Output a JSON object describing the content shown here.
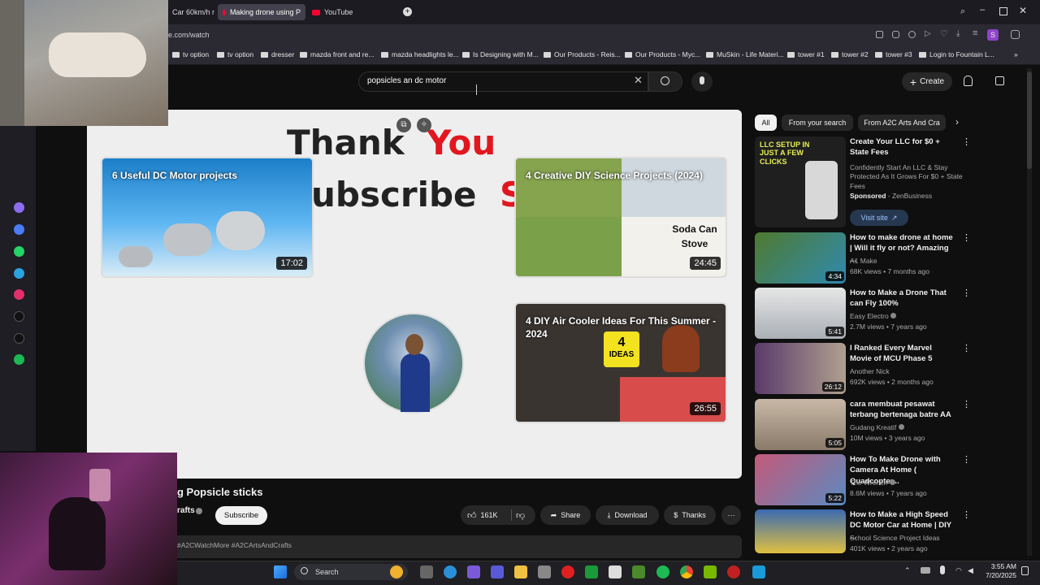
{
  "browser": {
    "tabs": [
      {
        "label": "Car 60km/h m",
        "active": false
      },
      {
        "label": "Making drone using P",
        "active": true
      },
      {
        "label": "YouTube",
        "active": false
      }
    ],
    "url": "e.com/watch",
    "bookmarks": [
      "tv option",
      "tv option",
      "dresser",
      "mazda front and re...",
      "mazda headlights le...",
      "Is Designing with M...",
      "Our Products - Reis...",
      "Our Products - Myc...",
      "MuSkin - Life Materi...",
      "tower #1",
      "tower #2",
      "tower #3",
      "Login to Fountain L..."
    ],
    "bookmarks_more": "»"
  },
  "youtube": {
    "search_value": "popsicles an dc motor",
    "create_label": "Create"
  },
  "video": {
    "endscreen_text_1": "Thank",
    "endscreen_text_1b": "You",
    "endscreen_text_2": "ubscribe",
    "endscreen_text_2b": "S",
    "cards": [
      {
        "title": "6 Useful DC Motor projects",
        "duration": "17:02"
      },
      {
        "title": "4 Creative DIY Science Projects (2024)",
        "duration": "24:45",
        "overlay_a": "Soda Can",
        "overlay_b": "Stove"
      },
      {
        "title": "4 DIY Air Cooler Ideas For This Summer - 2024",
        "duration": "26:55",
        "badge_num": "4",
        "badge_word": "IDEAS"
      }
    ]
  },
  "below_video": {
    "title": "g Popsicle sticks",
    "channel": "rafts",
    "subscribe": "Subscribe",
    "likes": "161K",
    "share": "Share",
    "download": "Download",
    "thanks": "Thanks",
    "more": "···",
    "hashtags": "#A2CWatchMore #A2CArtsAndCrafts"
  },
  "chips": [
    "All",
    "From your search",
    "From A2C Arts And Cra"
  ],
  "sponsored": {
    "thumb_text": "LLC SETUP IN JUST A FEW CLICKS",
    "title": "Create Your LLC for $0 + State Fees",
    "desc": "Confidently Start An LLC & Stay Protected As It Grows For $0 + State Fees",
    "label": "Sponsored",
    "advertiser": "ZenBusiness",
    "cta": "Visit site"
  },
  "related": [
    {
      "title": "How to make drone at home | Will it fly or not? Amazing ...",
      "channel": "A1 Make",
      "meta": "68K views • 7 months ago",
      "duration": "4:34"
    },
    {
      "title": "How to Make a Drone That can Fly 100%",
      "channel": "Easy Electro",
      "meta": "2.7M views • 7 years ago",
      "duration": "5:41"
    },
    {
      "title": "I Ranked Every Marvel Movie of MCU Phase 5",
      "channel": "Another Nick",
      "meta": "692K views • 2 months ago",
      "duration": "26:12"
    },
    {
      "title": "cara membuat pesawat terbang bertenaga batre AA",
      "channel": "Gudang Kreatif",
      "meta": "10M views • 3 years ago",
      "duration": "5:05"
    },
    {
      "title": "How To Make Drone with Camera At Home ( Quadcopter...",
      "channel": "The Wrench",
      "meta": "8.6M views • 7 years ago",
      "duration": "5:22"
    },
    {
      "title": "How to Make a High Speed DC Motor Car at Home | DIY ...",
      "channel": "School Science Project Ideas",
      "meta": "401K views • 2 years ago",
      "duration": ""
    }
  ],
  "taskbar": {
    "search": "Search",
    "time": "3:55 AM",
    "date": "7/20/2025"
  }
}
